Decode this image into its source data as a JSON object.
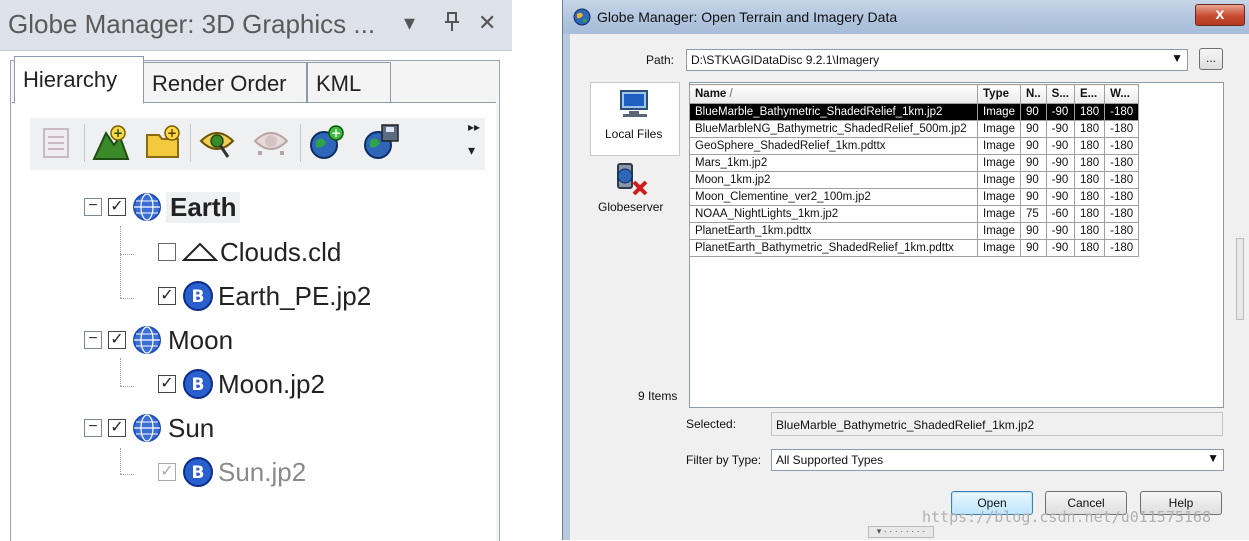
{
  "left_panel": {
    "title": "Globe Manager: 3D Graphics ...",
    "dropdown_glyph": "▾",
    "pin_glyph": "ᵻ",
    "close_glyph": "✕",
    "tabs": [
      {
        "label": "Hierarchy",
        "active": true
      },
      {
        "label": "Render Order",
        "active": false
      },
      {
        "label": "KML",
        "active": false
      }
    ],
    "toolbar_icons": [
      "properties-icon",
      "add-terrain-icon",
      "open-folder-icon",
      "view-icon",
      "hide-view-icon",
      "add-globe-icon",
      "save-globe-icon"
    ],
    "overflow_glyph": "▸▸",
    "tree": {
      "earth": {
        "label": "Earth",
        "checked": true
      },
      "clouds": {
        "label": "Clouds.cld",
        "checked": false
      },
      "earth_pe": {
        "label": "Earth_PE.jp2",
        "checked": true
      },
      "moon": {
        "label": "Moon",
        "checked": true
      },
      "moon_jp2": {
        "label": "Moon.jp2",
        "checked": true
      },
      "sun": {
        "label": "Sun",
        "checked": true
      },
      "sun_jp2": {
        "label": "Sun.jp2",
        "checked": true
      }
    }
  },
  "dialog": {
    "title": "Globe Manager: Open Terrain and Imagery Data",
    "close_glyph": "x",
    "path_label": "Path:",
    "path_value": "D:\\STK\\AGIDataDisc 9.2.1\\Imagery",
    "browse_label": "...",
    "sources": [
      {
        "label": "Local Files",
        "selected": true
      },
      {
        "label": "Globeserver",
        "selected": false
      }
    ],
    "columns": [
      "Name",
      "Type",
      "N..",
      "S...",
      "E...",
      "W..."
    ],
    "sort_glyph": "/",
    "rows": [
      [
        "BlueMarble_Bathymetric_ShadedRelief_1km.jp2",
        "Image",
        "90",
        "-90",
        "180",
        "-180"
      ],
      [
        "BlueMarbleNG_Bathymetric_ShadedRelief_500m.jp2",
        "Image",
        "90",
        "-90",
        "180",
        "-180"
      ],
      [
        "GeoSphere_ShadedRelief_1km.pdttx",
        "Image",
        "90",
        "-90",
        "180",
        "-180"
      ],
      [
        "Mars_1km.jp2",
        "Image",
        "90",
        "-90",
        "180",
        "-180"
      ],
      [
        "Moon_1km.jp2",
        "Image",
        "90",
        "-90",
        "180",
        "-180"
      ],
      [
        "Moon_Clementine_ver2_100m.jp2",
        "Image",
        "90",
        "-90",
        "180",
        "-180"
      ],
      [
        "NOAA_NightLights_1km.jp2",
        "Image",
        "75",
        "-60",
        "180",
        "-180"
      ],
      [
        "PlanetEarth_1km.pdttx",
        "Image",
        "90",
        "-90",
        "180",
        "-180"
      ],
      [
        "PlanetEarth_Bathymetric_ShadedRelief_1km.pdttx",
        "Image",
        "90",
        "-90",
        "180",
        "-180"
      ]
    ],
    "selected_row": 0,
    "item_count": "9 Items",
    "selected_label": "Selected:",
    "selected_value": "BlueMarble_Bathymetric_ShadedRelief_1km.jp2",
    "filter_label": "Filter by Type:",
    "filter_value": "All Supported Types",
    "buttons": {
      "open": "Open",
      "cancel": "Cancel",
      "help": "Help"
    },
    "grip": "▾ · · · · · · · ·"
  },
  "watermark": "https://blog.csdn.net/u011575168",
  "colors": {
    "selection": "#000000",
    "title_bar": "#dde2ea",
    "dialog_caption": "#b0c4de",
    "close_button": "#c84a2f",
    "globe_blue": "#1e4fb8"
  }
}
